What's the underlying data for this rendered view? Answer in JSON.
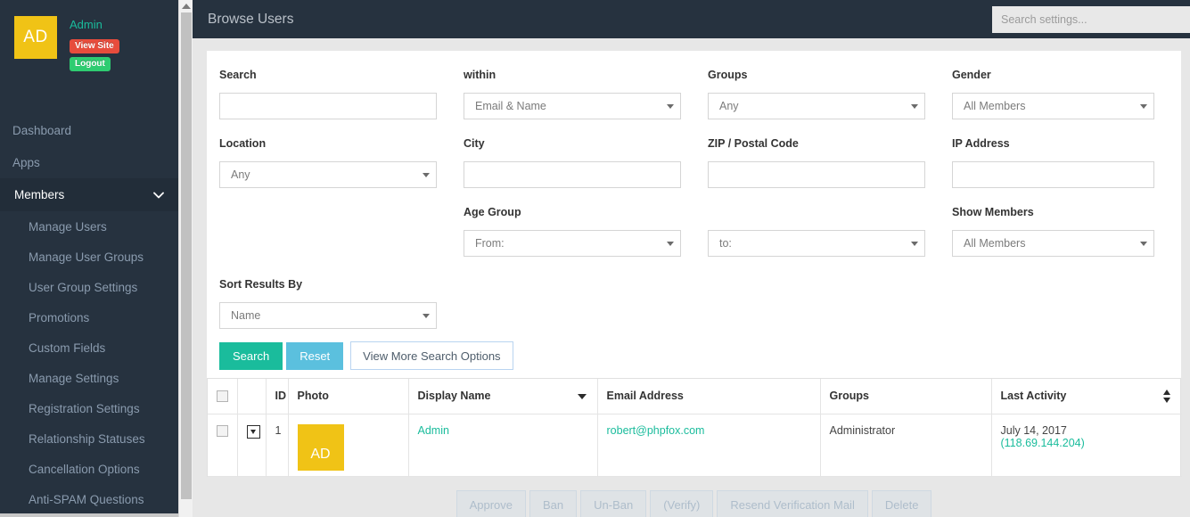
{
  "sidebar": {
    "profile": {
      "avatar_initials": "AD",
      "name": "Admin",
      "view_site_label": "View Site",
      "logout_label": "Logout"
    },
    "items": [
      {
        "label": "Dashboard",
        "type": "top"
      },
      {
        "label": "Apps",
        "type": "top"
      },
      {
        "label": "Members",
        "type": "parent",
        "expanded": true
      },
      {
        "label": "Manage Users",
        "type": "sub"
      },
      {
        "label": "Manage User Groups",
        "type": "sub"
      },
      {
        "label": "User Group Settings",
        "type": "sub"
      },
      {
        "label": "Promotions",
        "type": "sub"
      },
      {
        "label": "Custom Fields",
        "type": "sub"
      },
      {
        "label": "Manage Settings",
        "type": "sub"
      },
      {
        "label": "Registration Settings",
        "type": "sub"
      },
      {
        "label": "Relationship Statuses",
        "type": "sub"
      },
      {
        "label": "Cancellation Options",
        "type": "sub"
      },
      {
        "label": "Anti-SPAM Questions",
        "type": "sub"
      }
    ]
  },
  "topbar": {
    "title": "Browse Users",
    "search_placeholder": "Search settings...",
    "search_value": ""
  },
  "form": {
    "search": {
      "label": "Search",
      "value": "",
      "placeholder": ""
    },
    "within": {
      "label": "within",
      "value": "Email & Name"
    },
    "groups": {
      "label": "Groups",
      "value": "Any"
    },
    "gender": {
      "label": "Gender",
      "value": "All Members"
    },
    "location": {
      "label": "Location",
      "value": "Any"
    },
    "city": {
      "label": "City",
      "value": "",
      "placeholder": ""
    },
    "zip": {
      "label": "ZIP / Postal Code",
      "value": "",
      "placeholder": ""
    },
    "ip": {
      "label": "IP Address",
      "value": "",
      "placeholder": ""
    },
    "age_group": {
      "label": "Age Group",
      "from_value": "From:",
      "to_value": "to:"
    },
    "show_members": {
      "label": "Show Members",
      "value": "All Members"
    },
    "sort_by": {
      "label": "Sort Results By",
      "value": "Name"
    },
    "buttons": {
      "search": "Search",
      "reset": "Reset",
      "more_options": "View More Search Options"
    }
  },
  "table": {
    "columns": [
      {
        "key": "select",
        "label": ""
      },
      {
        "key": "menu",
        "label": ""
      },
      {
        "key": "id",
        "label": "ID"
      },
      {
        "key": "photo",
        "label": "Photo"
      },
      {
        "key": "display_name",
        "label": "Display Name",
        "sort": "desc"
      },
      {
        "key": "email",
        "label": "Email Address"
      },
      {
        "key": "groups",
        "label": "Groups"
      },
      {
        "key": "last_activity",
        "label": "Last Activity",
        "sort": "both"
      }
    ],
    "rows": [
      {
        "id": "1",
        "photo_initials": "AD",
        "display_name": "Admin",
        "email": "robert@phpfox.com",
        "groups": "Administrator",
        "last_activity_date": "July 14, 2017",
        "last_activity_ip": "(118.69.144.204)"
      }
    ]
  },
  "actions": [
    {
      "label": "Approve"
    },
    {
      "label": "Ban"
    },
    {
      "label": "Un-Ban"
    },
    {
      "label": "(Verify)"
    },
    {
      "label": "Resend Verification Mail"
    },
    {
      "label": "Delete"
    }
  ],
  "colors": {
    "sidebar_bg": "#26323f",
    "accent_teal": "#1abc9c",
    "avatar_yellow": "#f0c316",
    "pill_red": "#e74c3c",
    "pill_green": "#2ecc71",
    "reset_blue": "#5bc0de"
  }
}
